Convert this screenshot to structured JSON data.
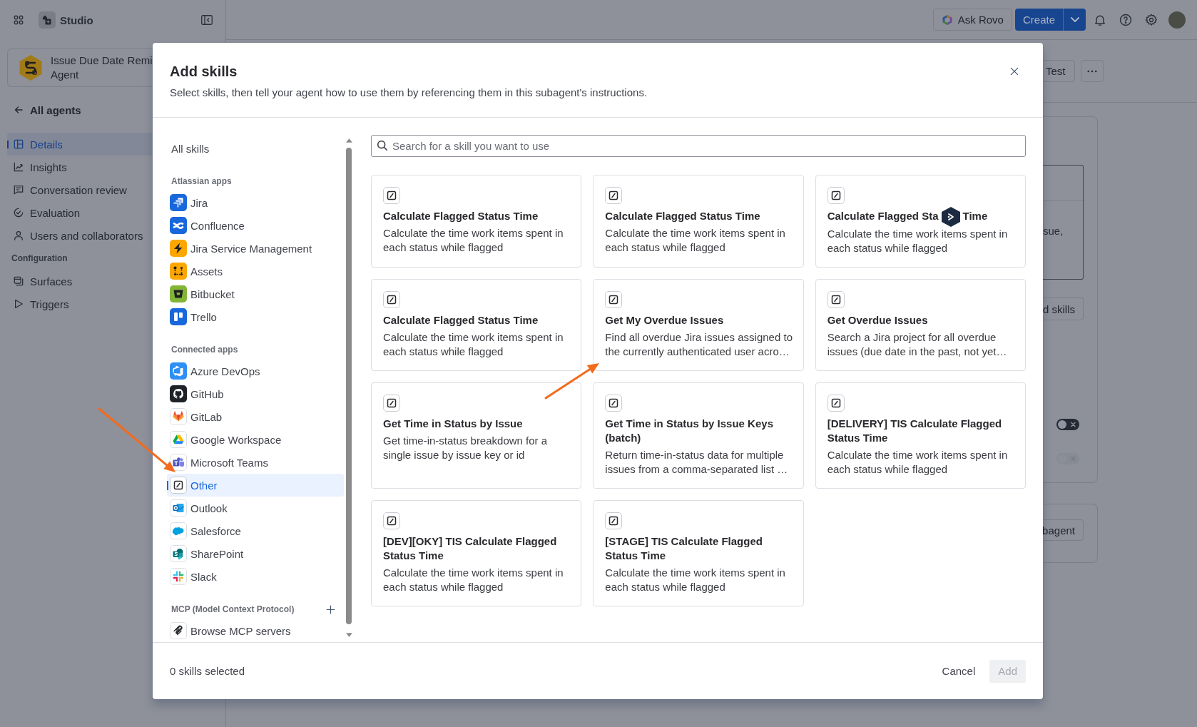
{
  "sidebar": {
    "product_name": "Studio",
    "agent_name_lines": [
      "Issue Due Date Remi",
      "Agent"
    ],
    "back_link": "All agents",
    "nav": [
      {
        "label": "Details",
        "selected": true
      },
      {
        "label": "Insights",
        "selected": false
      },
      {
        "label": "Conversation review",
        "selected": false
      },
      {
        "label": "Evaluation",
        "selected": false
      },
      {
        "label": "Users and collaborators",
        "selected": false
      }
    ],
    "sections": [
      {
        "heading": "Configuration",
        "items": [
          {
            "label": "Surfaces",
            "selected": false
          },
          {
            "label": "Triggers",
            "selected": false
          }
        ]
      }
    ]
  },
  "top_bar": {
    "ask_button": "Ask Rovo",
    "create_button": "Create"
  },
  "page": {
    "header_button": "Test",
    "field_text": "sue,",
    "panel_button": "d skills",
    "toggles": [
      {
        "on": false,
        "disabled": false
      },
      {
        "on": false,
        "disabled": true
      }
    ],
    "panel_2_button": "bagent"
  },
  "dialog": {
    "title": "Add skills",
    "subtitle": "Select skills, then tell your agent how to use them by referencing them in this subagent's instructions.",
    "nav": {
      "all": {
        "label": "All skills",
        "selected": false
      },
      "sections": [
        {
          "heading": "Atlassian apps",
          "add_button": false,
          "items": [
            {
              "label": "Jira",
              "selected": false
            },
            {
              "label": "Confluence",
              "selected": false
            },
            {
              "label": "Jira Service Management",
              "selected": false
            },
            {
              "label": "Assets",
              "selected": false
            },
            {
              "label": "Bitbucket",
              "selected": false
            },
            {
              "label": "Trello",
              "selected": false
            }
          ]
        },
        {
          "heading": "Connected apps",
          "add_button": false,
          "items": [
            {
              "label": "Azure DevOps",
              "selected": false
            },
            {
              "label": "GitHub",
              "selected": false
            },
            {
              "label": "GitLab",
              "selected": false
            },
            {
              "label": "Google Workspace",
              "selected": false
            },
            {
              "label": "Microsoft Teams",
              "selected": false
            },
            {
              "label": "Other",
              "selected": true
            },
            {
              "label": "Outlook",
              "selected": false
            },
            {
              "label": "Salesforce",
              "selected": false
            },
            {
              "label": "SharePoint",
              "selected": false
            },
            {
              "label": "Slack",
              "selected": false
            }
          ]
        },
        {
          "heading": "MCP (Model Context Protocol)",
          "add_button": true,
          "items": [
            {
              "label": "Browse MCP servers",
              "selected": false
            }
          ]
        }
      ]
    },
    "search": {
      "placeholder": "Search for a skill you want to use"
    },
    "skills": [
      {
        "title": "Calculate Flagged Status Time",
        "description": "Calculate the time work items spent in each status while flagged",
        "selected": false
      },
      {
        "title": "Calculate Flagged Status Time",
        "description": "Calculate the time work items spent in each status while flagged",
        "selected": false
      },
      {
        "title": "Calculate Flagged Sta",
        "title_tail": "Time",
        "description": "Calculate the time work items spent in each status while flagged",
        "selected": false
      },
      {
        "title": "Calculate Flagged Status Time",
        "description": "Calculate the time work items spent in each status while flagged",
        "selected": false
      },
      {
        "title": "Get My Overdue Issues",
        "description": "Find all overdue Jira issues assigned to the currently authenticated user acro…",
        "selected": false
      },
      {
        "title": "Get Overdue Issues",
        "description": "Search a Jira project for all overdue issues (due date in the past, not yet…",
        "selected": false
      },
      {
        "title": "Get Time in Status by Issue",
        "description": "Get time-in-status breakdown for a single issue by issue key or id",
        "selected": false
      },
      {
        "title": "Get Time in Status by Issue Keys (batch)",
        "description": "Return time-in-status data for multiple issues from a comma-separated list …",
        "selected": false
      },
      {
        "title": "[DELIVERY] TIS Calculate Flagged Status Time",
        "description": "Calculate the time work items spent in each status while flagged",
        "selected": false
      },
      {
        "title": "[DEV][OKY] TIS Calculate Flagged Status Time",
        "description": "Calculate the time work items spent in each status while flagged",
        "selected": false
      },
      {
        "title": "[STAGE] TIS Calculate Flagged Status Time",
        "description": "Calculate the time work items spent in each status while flagged",
        "selected": false
      }
    ],
    "footer": {
      "count": "0 skills selected",
      "cancel_button": "Cancel",
      "add_button": {
        "label": "Add",
        "disabled": true
      }
    }
  }
}
